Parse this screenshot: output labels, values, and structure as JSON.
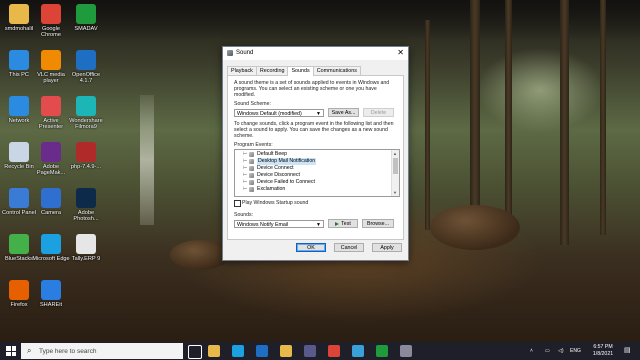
{
  "desktop": {
    "icons": [
      {
        "label": "smdmohalil",
        "icon": "user-folder-icon",
        "color": "#e8b94a"
      },
      {
        "label": "Google Chrome",
        "icon": "chrome-icon",
        "color": "#db4437"
      },
      {
        "label": "SMADAV",
        "icon": "smadav-icon",
        "color": "#1f9a3c"
      },
      {
        "label": "This PC",
        "icon": "this-pc-icon",
        "color": "#2b8be0"
      },
      {
        "label": "VLC media player",
        "icon": "vlc-icon",
        "color": "#f08a00"
      },
      {
        "label": "OpenOffice 4.1.7",
        "icon": "openoffice-icon",
        "color": "#1e6fc3"
      },
      {
        "label": "Network",
        "icon": "network-icon",
        "color": "#2b8be0"
      },
      {
        "label": "Active Presenter",
        "icon": "activepresenter-icon",
        "color": "#e34c4c"
      },
      {
        "label": "Wondershare Filmora9",
        "icon": "filmora-icon",
        "color": "#1db6b6"
      },
      {
        "label": "Recycle Bin",
        "icon": "recycle-bin-icon",
        "color": "#c9d6e6"
      },
      {
        "label": "Adobe PageMak...",
        "icon": "pagemaker-icon",
        "color": "#6a2c8a"
      },
      {
        "label": "php-7.4.9-...",
        "icon": "php-archive-icon",
        "color": "#b02a2a"
      },
      {
        "label": "Control Panel",
        "icon": "control-panel-icon",
        "color": "#3a7bd5"
      },
      {
        "label": "Camera",
        "icon": "camera-icon",
        "color": "#2f6fd0"
      },
      {
        "label": "Adobe Photosh...",
        "icon": "photoshop-icon",
        "color": "#0d2a4a"
      },
      {
        "label": "BlueStacks",
        "icon": "bluestacks-icon",
        "color": "#43b04a"
      },
      {
        "label": "Microsoft Edge",
        "icon": "edge-icon",
        "color": "#1ba1e2"
      },
      {
        "label": "Tally.ERP 9",
        "icon": "tally-icon",
        "color": "#e6e6e6"
      },
      {
        "label": "Firefox",
        "icon": "firefox-icon",
        "color": "#e66000"
      },
      {
        "label": "SHAREit",
        "icon": "shareit-icon",
        "color": "#2a7de1"
      }
    ]
  },
  "dialog": {
    "title": "Sound",
    "close_glyph": "✕",
    "tabs": [
      "Playback",
      "Recording",
      "Sounds",
      "Communications"
    ],
    "active_tab": "Sounds",
    "description": "A sound theme is a set of sounds applied to events in Windows and programs. You can select an existing scheme or one you have modified.",
    "scheme_label": "Sound Scheme:",
    "scheme_value": "Windows Default (modified)",
    "save_as_label": "Save As...",
    "delete_label": "Delete",
    "instructions": "To change sounds, click a program event in the following list and then select a sound to apply. You can save the changes as a new sound scheme.",
    "events_label": "Program Events:",
    "events": [
      {
        "label": "Default Beep",
        "selected": false
      },
      {
        "label": "Desktop Mail Notification",
        "selected": true
      },
      {
        "label": "Device Connect",
        "selected": false
      },
      {
        "label": "Device Disconnect",
        "selected": false
      },
      {
        "label": "Device Failed to Connect",
        "selected": false
      },
      {
        "label": "Exclamation",
        "selected": false
      }
    ],
    "startup_label": "Play Windows Startup sound",
    "startup_checked": false,
    "sounds_label": "Sounds:",
    "sounds_value": "Windows Notify Email",
    "test_label": "Test",
    "browse_label": "Browse...",
    "ok_label": "OK",
    "cancel_label": "Cancel",
    "apply_label": "Apply"
  },
  "taskbar": {
    "search_placeholder": "Type here to search",
    "pinned": [
      "task-view-icon",
      "file-explorer-icon",
      "edge-icon",
      "mail-icon",
      "folder-icon",
      "store-icon",
      "chrome-icon",
      "media-icon",
      "smadav-icon",
      "sound-settings-icon"
    ],
    "language": "ENG",
    "time": "6:57 PM",
    "date": "1/8/2021"
  }
}
